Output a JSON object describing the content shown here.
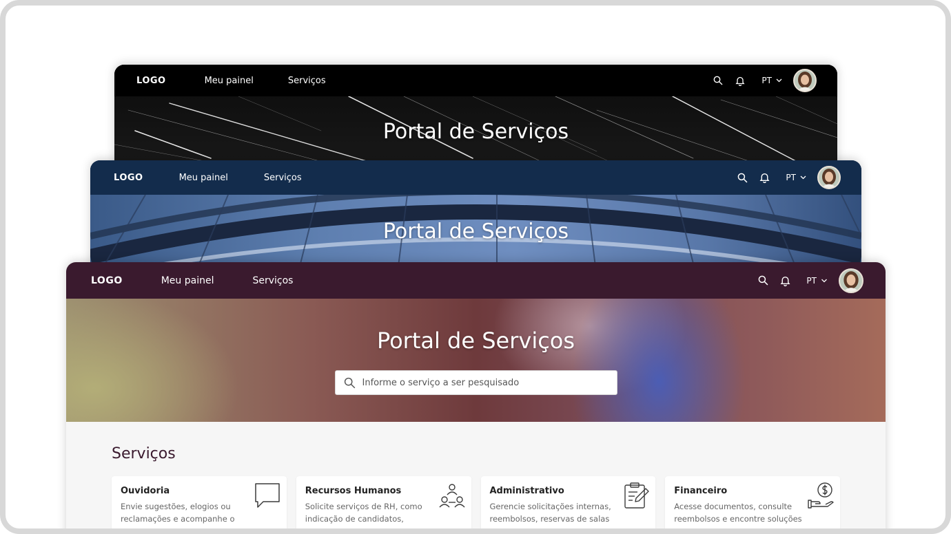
{
  "windows": [
    {
      "theme": "black",
      "nav": {
        "logo": "LOGO",
        "links": [
          "Meu painel",
          "Serviços"
        ],
        "lang": "PT"
      },
      "hero": {
        "title": "Portal de Serviços"
      }
    },
    {
      "theme": "navy",
      "nav": {
        "logo": "LOGO",
        "links": [
          "Meu painel",
          "Serviços"
        ],
        "lang": "PT"
      },
      "hero": {
        "title": "Portal de Serviços"
      }
    },
    {
      "theme": "plum",
      "nav": {
        "logo": "LOGO",
        "links": [
          "Meu painel",
          "Serviços"
        ],
        "lang": "PT"
      },
      "hero": {
        "title": "Portal de Serviços",
        "search_placeholder": "Informe o serviço a ser pesquisado"
      },
      "services": {
        "title": "Serviços",
        "cards": [
          {
            "title": "Ouvidoria",
            "desc": "Envie sugestões, elogios ou reclamações e acompanhe o",
            "icon": "chat-bubble-icon"
          },
          {
            "title": "Recursos Humanos",
            "desc": "Solicite serviços de RH, como indicação de candidatos,",
            "icon": "people-network-icon"
          },
          {
            "title": "Administrativo",
            "desc": "Gerencie solicitações internas, reembolsos, reservas de salas",
            "icon": "clipboard-edit-icon"
          },
          {
            "title": "Financeiro",
            "desc": "Acesse documentos, consulte reembolsos e encontre soluções",
            "icon": "money-hand-icon"
          }
        ]
      }
    }
  ],
  "colors": {
    "nav_black": "#000000",
    "nav_navy": "#132c4c",
    "nav_plum": "#3a1a2e",
    "content_bg": "#f6f6f6"
  }
}
